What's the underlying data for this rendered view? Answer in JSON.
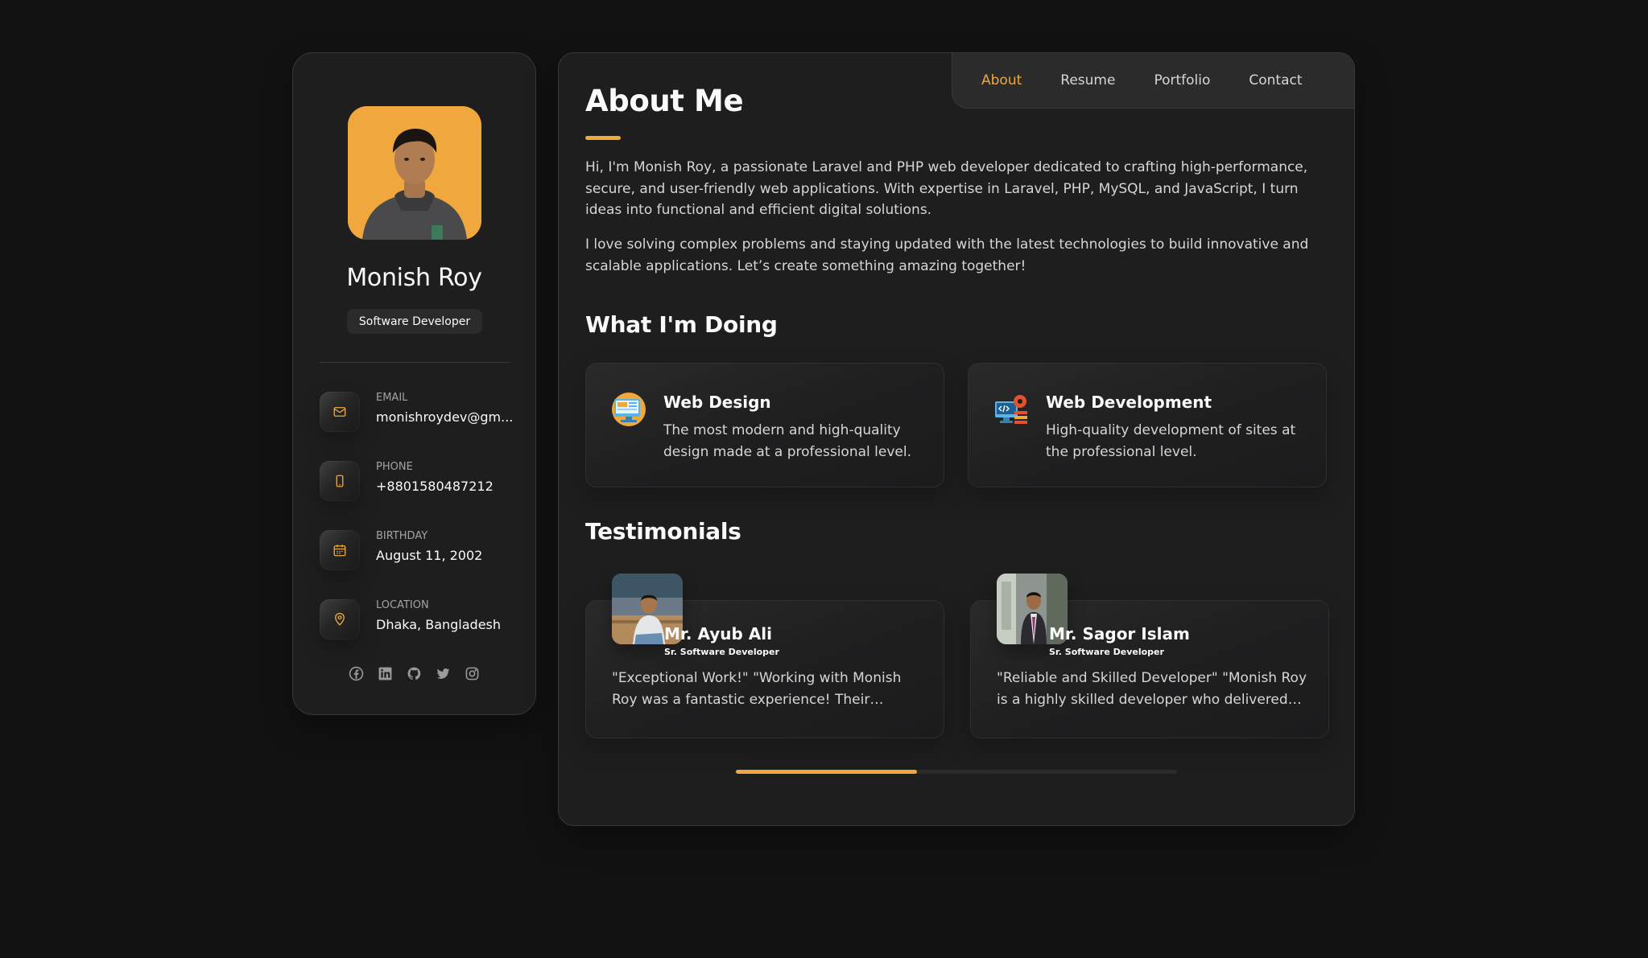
{
  "profile": {
    "name": "Monish Roy",
    "title": "Software Developer",
    "avatar_bg": "#f0a83e"
  },
  "contacts": [
    {
      "label": "EMAIL",
      "value": "monishroydev@gm...",
      "icon": "mail-icon"
    },
    {
      "label": "PHONE",
      "value": "+8801580487212",
      "icon": "phone-icon"
    },
    {
      "label": "BIRTHDAY",
      "value": "August 11, 2002",
      "icon": "calendar-icon"
    },
    {
      "label": "LOCATION",
      "value": "Dhaka, Bangladesh",
      "icon": "location-pin-icon"
    }
  ],
  "socials": [
    "facebook-icon",
    "linkedin-icon",
    "github-icon",
    "twitter-icon",
    "instagram-icon"
  ],
  "nav": {
    "items": [
      {
        "label": "About",
        "active": true
      },
      {
        "label": "Resume",
        "active": false
      },
      {
        "label": "Portfolio",
        "active": false
      },
      {
        "label": "Contact",
        "active": false
      }
    ]
  },
  "about": {
    "heading": "About Me",
    "paragraphs": [
      "Hi, I'm Monish Roy, a passionate Laravel and PHP web developer dedicated to crafting high-performance, secure, and user-friendly web applications. With expertise in Laravel, PHP, MySQL, and JavaScript, I turn ideas into functional and efficient digital solutions.",
      "I love solving complex problems and staying updated with the latest technologies to build innovative and scalable applications. Let’s create something amazing together!"
    ]
  },
  "services": {
    "heading": "What I'm Doing",
    "items": [
      {
        "title": "Web Design",
        "text": "The most modern and high-quality design made at a professional level.",
        "icon": "web-design-icon"
      },
      {
        "title": "Web Development",
        "text": "High-quality development of sites at the professional level.",
        "icon": "web-development-icon"
      }
    ]
  },
  "testimonials": {
    "heading": "Testimonials",
    "items": [
      {
        "name": "Mr. Ayub Ali",
        "role": "Sr. Software Developer",
        "text": "\"Exceptional Work!\" \"Working with Monish Roy was a fantastic experience! Their expertise in Laravel and PHP helped us deliver our project on time.\""
      },
      {
        "name": "Mr. Sagor Islam",
        "role": "Sr. Software Developer",
        "text": "\"Reliable and Skilled Developer\" \"Monish Roy is a highly skilled developer who delivered our project with great quality.\""
      }
    ],
    "scroll_progress": 0.41
  },
  "colors": {
    "accent": "#f0a83e",
    "background": "#121212",
    "card": "#1e1e1f",
    "border": "#383838"
  }
}
